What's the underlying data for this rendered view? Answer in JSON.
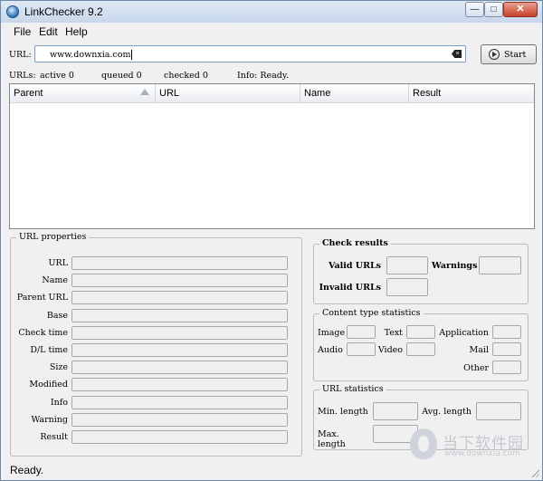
{
  "window": {
    "title": "LinkChecker 9.2"
  },
  "menu": [
    "File",
    "Edit",
    "Help"
  ],
  "url": {
    "label": "URL:",
    "value": "www.downxia.com",
    "start_label": "Start"
  },
  "status": {
    "urls_label": "URLs:",
    "active": "active 0",
    "queued": "queued 0",
    "checked": "checked 0",
    "info": "Info: Ready."
  },
  "table": {
    "columns": [
      "Parent",
      "URL",
      "Name",
      "Result"
    ],
    "rows": []
  },
  "url_properties": {
    "title": "URL properties",
    "fields": [
      "URL",
      "Name",
      "Parent URL",
      "Base",
      "Check time",
      "D/L time",
      "Size",
      "Modified",
      "Info",
      "Warning",
      "Result"
    ]
  },
  "check_results": {
    "title": "Check results",
    "valid_label": "Valid URLs",
    "warnings_label": "Warnings",
    "invalid_label": "Invalid URLs"
  },
  "content_stats": {
    "title": "Content type statistics",
    "image": "Image",
    "text": "Text",
    "application": "Application",
    "audio": "Audio",
    "video": "Video",
    "mail": "Mail",
    "other": "Other"
  },
  "url_stats": {
    "title": "URL statistics",
    "min_length": "Min. length",
    "avg_length": "Avg. length",
    "max_length": "Max. length"
  },
  "statusbar": {
    "text": "Ready."
  },
  "watermark": {
    "cn": "当下软件园",
    "url": "www.downxia.com"
  }
}
